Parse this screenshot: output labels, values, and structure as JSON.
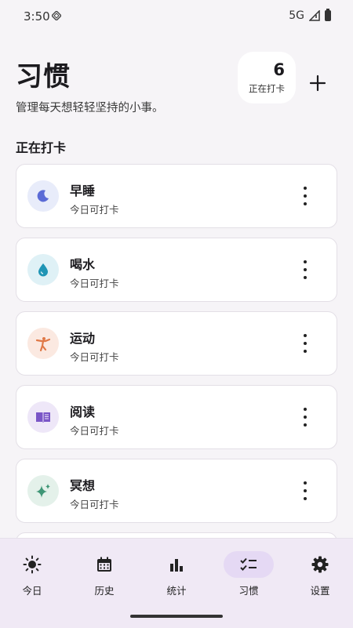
{
  "status_bar": {
    "time": "3:50",
    "network": "5G"
  },
  "header": {
    "title": "习惯",
    "subtitle": "管理每天想轻轻坚持的小事。",
    "active_count": "6",
    "active_label": "正在打卡"
  },
  "section_title": "正在打卡",
  "habits": [
    {
      "name": "早睡",
      "status": "今日可打卡",
      "icon": "moon-icon",
      "color": "#5b6bd6",
      "bg": "#e8ecfa"
    },
    {
      "name": "喝水",
      "status": "今日可打卡",
      "icon": "water-drop-icon",
      "color": "#1f95b5",
      "bg": "#dff1f6"
    },
    {
      "name": "运动",
      "status": "今日可打卡",
      "icon": "exercise-icon",
      "color": "#e07846",
      "bg": "#fbe9e1"
    },
    {
      "name": "阅读",
      "status": "今日可打卡",
      "icon": "book-icon",
      "color": "#7a56c7",
      "bg": "#eee7f8"
    },
    {
      "name": "冥想",
      "status": "今日可打卡",
      "icon": "sparkle-icon",
      "color": "#3f9676",
      "bg": "#e4f1ea"
    }
  ],
  "nav": [
    {
      "label": "今日",
      "icon": "sun-icon",
      "active": false
    },
    {
      "label": "历史",
      "icon": "calendar-icon",
      "active": false
    },
    {
      "label": "统计",
      "icon": "bar-chart-icon",
      "active": false
    },
    {
      "label": "习惯",
      "icon": "checklist-icon",
      "active": true
    },
    {
      "label": "设置",
      "icon": "gear-icon",
      "active": false
    }
  ]
}
